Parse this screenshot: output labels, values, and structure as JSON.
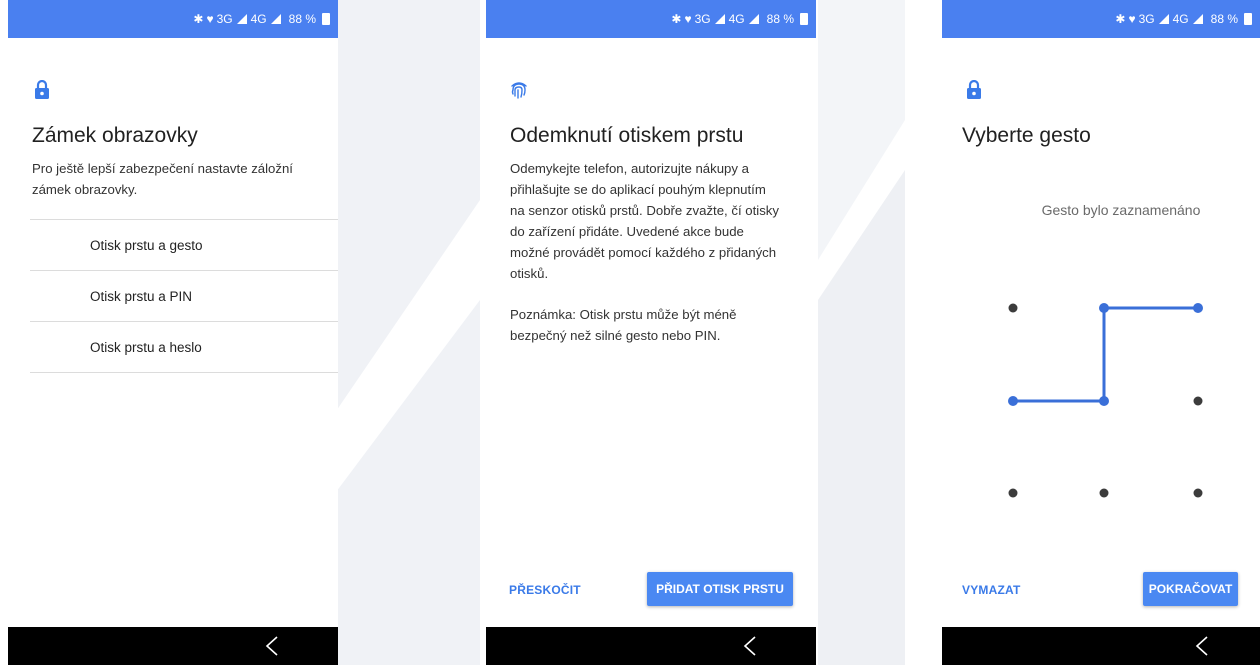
{
  "status_bar": {
    "network": "3G",
    "network2": "4G",
    "battery": "88 %"
  },
  "nav": {
    "back_label": "<"
  },
  "screen1": {
    "title": "Zámek obrazovky",
    "description": "Pro ještě lepší zabezpečení nastavte záložní zámek obrazovky.",
    "options": [
      "Otisk prstu a gesto",
      "Otisk prstu a PIN",
      "Otisk prstu a heslo"
    ]
  },
  "screen2": {
    "title": "Odemknutí otiskem prstu",
    "description": "Odemykejte telefon, autorizujte nákupy a přihlašujte se do aplikací pouhým klepnutím na senzor otisků prstů. Dobře zvažte, čí otisky do zařízení přidáte. Uvedené akce bude možné provádět pomocí každého z přidaných otisků.",
    "note": "Poznámka: Otisk prstu může být méně bezpečný než silné gesto nebo PIN.",
    "skip_label": "PŘESKOČIT",
    "add_label": "PŘIDAT OTISK PRSTU"
  },
  "screen3": {
    "title": "Vyberte gesto",
    "status": "Gesto bylo zaznamenáno",
    "clear_label": "VYMAZAT",
    "continue_label": "POKRAČOVAT"
  },
  "colors": {
    "accent": "#4a80f0",
    "pattern_line": "#3a6fd8",
    "dot": "#3c3c3c"
  }
}
